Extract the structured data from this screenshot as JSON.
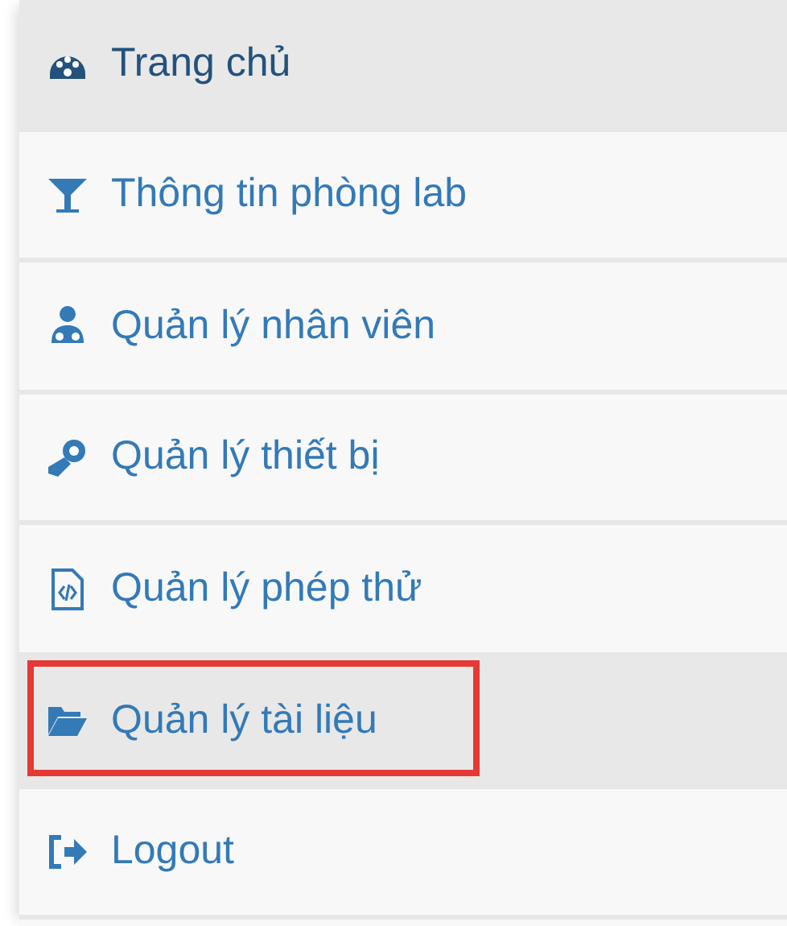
{
  "menu": {
    "items": [
      {
        "label": "Trang chủ",
        "selected": true,
        "highlighted": true,
        "outlined": false
      },
      {
        "label": "Thông tin phòng lab",
        "selected": false,
        "highlighted": false,
        "outlined": false
      },
      {
        "label": "Quản lý nhân viên",
        "selected": false,
        "highlighted": false,
        "outlined": false
      },
      {
        "label": "Quản lý thiết bị",
        "selected": false,
        "highlighted": false,
        "outlined": false
      },
      {
        "label": "Quản lý phép thử",
        "selected": false,
        "highlighted": false,
        "outlined": false
      },
      {
        "label": "Quản lý tài liệu",
        "selected": false,
        "highlighted": true,
        "outlined": true
      },
      {
        "label": "Logout",
        "selected": false,
        "highlighted": false,
        "outlined": false
      }
    ]
  }
}
